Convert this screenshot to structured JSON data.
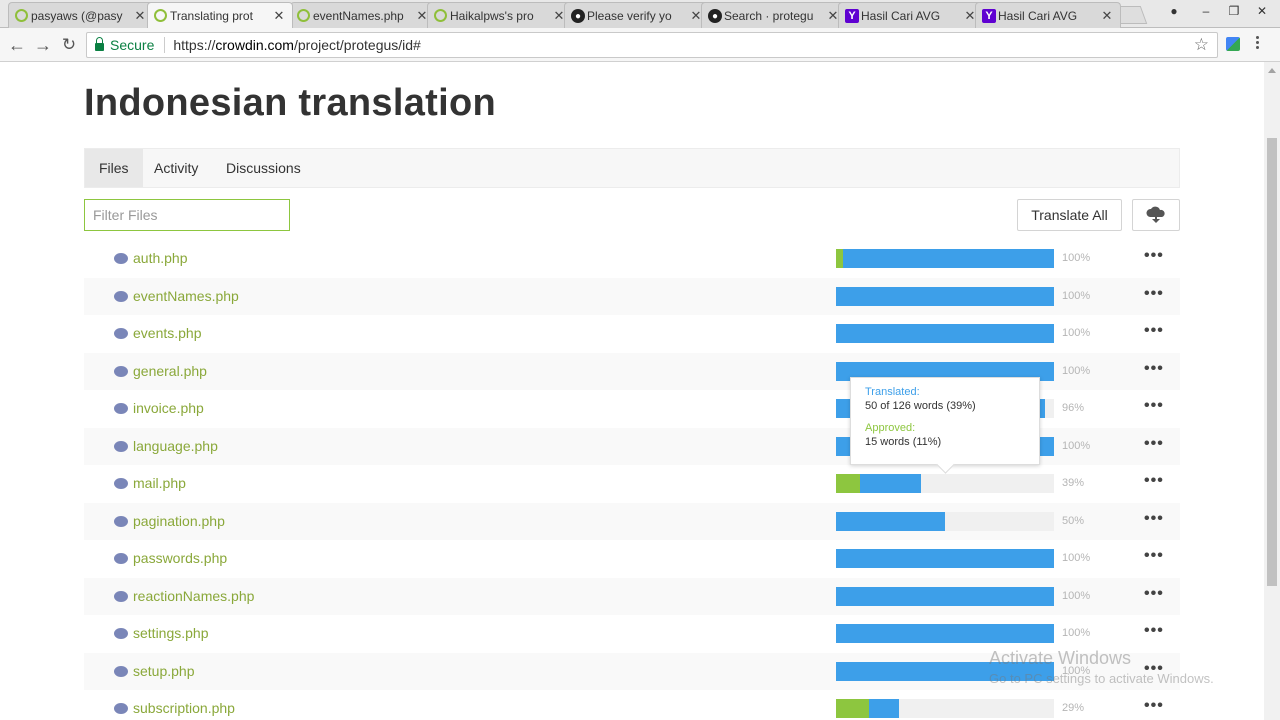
{
  "browser": {
    "tabs": [
      {
        "title": "pasyaws (@pasy",
        "icon": "crowdin-icon",
        "active": false
      },
      {
        "title": "Translating prot",
        "icon": "crowdin-icon",
        "active": true
      },
      {
        "title": "eventNames.php",
        "icon": "crowdin-icon",
        "active": false
      },
      {
        "title": "Haikalpws's pro",
        "icon": "crowdin-icon",
        "active": false
      },
      {
        "title": "Please verify yo",
        "icon": "github-icon",
        "active": false
      },
      {
        "title": "Search · protegu",
        "icon": "github-icon",
        "active": false
      },
      {
        "title": "Hasil Cari AVG",
        "icon": "yahoo-icon",
        "active": false
      },
      {
        "title": "Hasil Cari AVG",
        "icon": "yahoo-icon",
        "active": false
      }
    ],
    "secure_label": "Secure",
    "url_scheme": "https://",
    "url_domain": "crowdin.com",
    "url_path": "/project/protegus/id#"
  },
  "page": {
    "title": "Indonesian translation",
    "tabs": [
      "Files",
      "Activity",
      "Discussions"
    ],
    "filter_placeholder": "Filter Files",
    "translate_all_label": "Translate All",
    "download_icon": "cloud-download-icon"
  },
  "files": [
    {
      "name": "auth.php",
      "translated": 100,
      "approved": 3,
      "pct_label": "100%"
    },
    {
      "name": "eventNames.php",
      "translated": 100,
      "approved": 0,
      "pct_label": "100%"
    },
    {
      "name": "events.php",
      "translated": 100,
      "approved": 0,
      "pct_label": "100%"
    },
    {
      "name": "general.php",
      "translated": 100,
      "approved": 0,
      "pct_label": "100%"
    },
    {
      "name": "invoice.php",
      "translated": 96,
      "approved": 0,
      "pct_label": "96%"
    },
    {
      "name": "language.php",
      "translated": 100,
      "approved": 0,
      "pct_label": "100%"
    },
    {
      "name": "mail.php",
      "translated": 39,
      "approved": 11,
      "pct_label": "39%"
    },
    {
      "name": "pagination.php",
      "translated": 50,
      "approved": 0,
      "pct_label": "50%"
    },
    {
      "name": "passwords.php",
      "translated": 100,
      "approved": 0,
      "pct_label": "100%"
    },
    {
      "name": "reactionNames.php",
      "translated": 100,
      "approved": 0,
      "pct_label": "100%"
    },
    {
      "name": "settings.php",
      "translated": 100,
      "approved": 0,
      "pct_label": "100%"
    },
    {
      "name": "setup.php",
      "translated": 100,
      "approved": 0,
      "pct_label": "100%"
    },
    {
      "name": "subscription.php",
      "translated": 29,
      "approved": 15,
      "pct_label": "29%"
    }
  ],
  "tooltip": {
    "translated_label": "Translated:",
    "translated_value": "50 of 126 words (39%)",
    "approved_label": "Approved:",
    "approved_value": "15 words (11%)"
  },
  "watermark": {
    "line1": "Activate Windows",
    "line2": "Go to PC settings to activate Windows."
  },
  "colors": {
    "translated": "#3d9fe9",
    "approved": "#8dc63f",
    "link": "#8aa83a"
  }
}
